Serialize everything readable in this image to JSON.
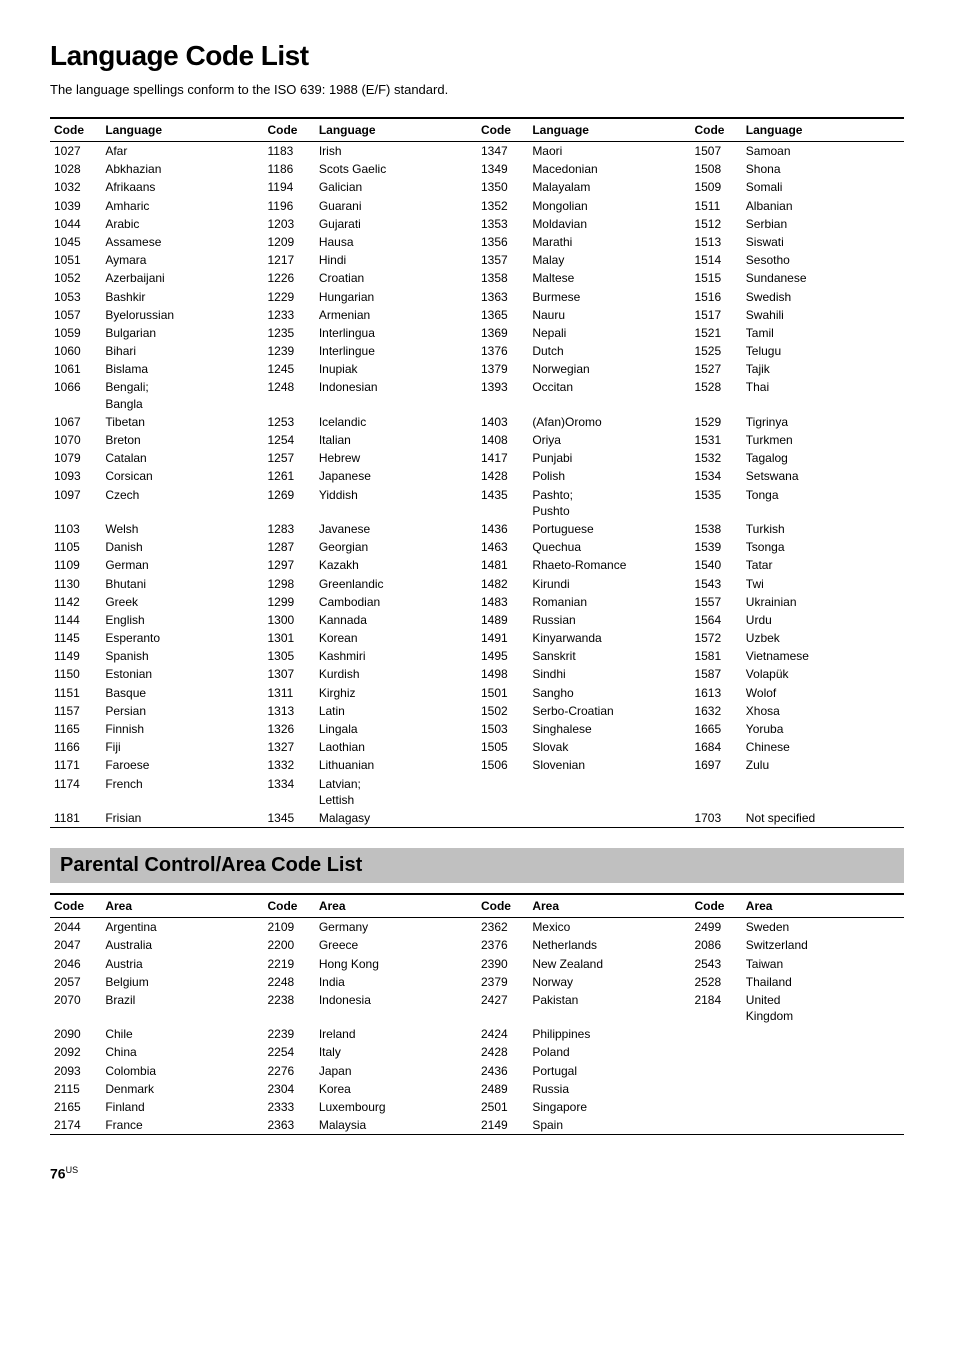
{
  "page": {
    "title": "Language Code List",
    "subtitle": "The language spellings conform to the ISO 639: 1988 (E/F) standard.",
    "page_number": "76",
    "page_suffix": "US"
  },
  "language_table": {
    "columns": [
      {
        "code_header": "Code",
        "lang_header": "Language"
      },
      {
        "code_header": "Code",
        "lang_header": "Language"
      },
      {
        "code_header": "Code",
        "lang_header": "Language"
      },
      {
        "code_header": "Code",
        "lang_header": "Language"
      }
    ],
    "col1": [
      {
        "code": "1027",
        "lang": "Afar"
      },
      {
        "code": "1028",
        "lang": "Abkhazian"
      },
      {
        "code": "1032",
        "lang": "Afrikaans"
      },
      {
        "code": "1039",
        "lang": "Amharic"
      },
      {
        "code": "1044",
        "lang": "Arabic"
      },
      {
        "code": "1045",
        "lang": "Assamese"
      },
      {
        "code": "1051",
        "lang": "Aymara"
      },
      {
        "code": "1052",
        "lang": "Azerbaijani"
      },
      {
        "code": "1053",
        "lang": "Bashkir"
      },
      {
        "code": "1057",
        "lang": "Byelorussian"
      },
      {
        "code": "1059",
        "lang": "Bulgarian"
      },
      {
        "code": "1060",
        "lang": "Bihari"
      },
      {
        "code": "1061",
        "lang": "Bislama"
      },
      {
        "code": "1066",
        "lang": "Bengali; Bangla"
      },
      {
        "code": "1067",
        "lang": "Tibetan"
      },
      {
        "code": "1070",
        "lang": "Breton"
      },
      {
        "code": "1079",
        "lang": "Catalan"
      },
      {
        "code": "1093",
        "lang": "Corsican"
      },
      {
        "code": "1097",
        "lang": "Czech"
      },
      {
        "code": "1103",
        "lang": "Welsh"
      },
      {
        "code": "1105",
        "lang": "Danish"
      },
      {
        "code": "1109",
        "lang": "German"
      },
      {
        "code": "1130",
        "lang": "Bhutani"
      },
      {
        "code": "1142",
        "lang": "Greek"
      },
      {
        "code": "1144",
        "lang": "English"
      },
      {
        "code": "1145",
        "lang": "Esperanto"
      },
      {
        "code": "1149",
        "lang": "Spanish"
      },
      {
        "code": "1150",
        "lang": "Estonian"
      },
      {
        "code": "1151",
        "lang": "Basque"
      },
      {
        "code": "1157",
        "lang": "Persian"
      },
      {
        "code": "1165",
        "lang": "Finnish"
      },
      {
        "code": "1166",
        "lang": "Fiji"
      },
      {
        "code": "1171",
        "lang": "Faroese"
      },
      {
        "code": "1174",
        "lang": "French"
      },
      {
        "code": "1181",
        "lang": "Frisian"
      }
    ],
    "col2": [
      {
        "code": "1183",
        "lang": "Irish"
      },
      {
        "code": "1186",
        "lang": "Scots Gaelic"
      },
      {
        "code": "1194",
        "lang": "Galician"
      },
      {
        "code": "1196",
        "lang": "Guarani"
      },
      {
        "code": "1203",
        "lang": "Gujarati"
      },
      {
        "code": "1209",
        "lang": "Hausa"
      },
      {
        "code": "1217",
        "lang": "Hindi"
      },
      {
        "code": "1226",
        "lang": "Croatian"
      },
      {
        "code": "1229",
        "lang": "Hungarian"
      },
      {
        "code": "1233",
        "lang": "Armenian"
      },
      {
        "code": "1235",
        "lang": "Interlingua"
      },
      {
        "code": "1239",
        "lang": "Interlingue"
      },
      {
        "code": "1245",
        "lang": "Inupiak"
      },
      {
        "code": "1248",
        "lang": "Indonesian"
      },
      {
        "code": "1253",
        "lang": "Icelandic"
      },
      {
        "code": "1254",
        "lang": "Italian"
      },
      {
        "code": "1257",
        "lang": "Hebrew"
      },
      {
        "code": "1261",
        "lang": "Japanese"
      },
      {
        "code": "1269",
        "lang": "Yiddish"
      },
      {
        "code": "1283",
        "lang": "Javanese"
      },
      {
        "code": "1287",
        "lang": "Georgian"
      },
      {
        "code": "1297",
        "lang": "Kazakh"
      },
      {
        "code": "1298",
        "lang": "Greenlandic"
      },
      {
        "code": "1299",
        "lang": "Cambodian"
      },
      {
        "code": "1300",
        "lang": "Kannada"
      },
      {
        "code": "1301",
        "lang": "Korean"
      },
      {
        "code": "1305",
        "lang": "Kashmiri"
      },
      {
        "code": "1307",
        "lang": "Kurdish"
      },
      {
        "code": "1311",
        "lang": "Kirghiz"
      },
      {
        "code": "1313",
        "lang": "Latin"
      },
      {
        "code": "1326",
        "lang": "Lingala"
      },
      {
        "code": "1327",
        "lang": "Laothian"
      },
      {
        "code": "1332",
        "lang": "Lithuanian"
      },
      {
        "code": "1334",
        "lang": "Latvian; Lettish"
      },
      {
        "code": "1345",
        "lang": "Malagasy"
      }
    ],
    "col3": [
      {
        "code": "1347",
        "lang": "Maori"
      },
      {
        "code": "1349",
        "lang": "Macedonian"
      },
      {
        "code": "1350",
        "lang": "Malayalam"
      },
      {
        "code": "1352",
        "lang": "Mongolian"
      },
      {
        "code": "1353",
        "lang": "Moldavian"
      },
      {
        "code": "1356",
        "lang": "Marathi"
      },
      {
        "code": "1357",
        "lang": "Malay"
      },
      {
        "code": "1358",
        "lang": "Maltese"
      },
      {
        "code": "1363",
        "lang": "Burmese"
      },
      {
        "code": "1365",
        "lang": "Nauru"
      },
      {
        "code": "1369",
        "lang": "Nepali"
      },
      {
        "code": "1376",
        "lang": "Dutch"
      },
      {
        "code": "1379",
        "lang": "Norwegian"
      },
      {
        "code": "1393",
        "lang": "Occitan"
      },
      {
        "code": "1403",
        "lang": "(Afan)Oromo"
      },
      {
        "code": "1408",
        "lang": "Oriya"
      },
      {
        "code": "1417",
        "lang": "Punjabi"
      },
      {
        "code": "1428",
        "lang": "Polish"
      },
      {
        "code": "1435",
        "lang": "Pashto; Pushto"
      },
      {
        "code": "1436",
        "lang": "Portuguese"
      },
      {
        "code": "1463",
        "lang": "Quechua"
      },
      {
        "code": "1481",
        "lang": "Rhaeto-Romance"
      },
      {
        "code": "1482",
        "lang": "Kirundi"
      },
      {
        "code": "1483",
        "lang": "Romanian"
      },
      {
        "code": "1489",
        "lang": "Russian"
      },
      {
        "code": "1491",
        "lang": "Kinyarwanda"
      },
      {
        "code": "1495",
        "lang": "Sanskrit"
      },
      {
        "code": "1498",
        "lang": "Sindhi"
      },
      {
        "code": "1501",
        "lang": "Sangho"
      },
      {
        "code": "1502",
        "lang": "Serbo-Croatian"
      },
      {
        "code": "1503",
        "lang": "Singhalese"
      },
      {
        "code": "1505",
        "lang": "Slovak"
      },
      {
        "code": "1506",
        "lang": "Slovenian"
      }
    ],
    "col4": [
      {
        "code": "1507",
        "lang": "Samoan"
      },
      {
        "code": "1508",
        "lang": "Shona"
      },
      {
        "code": "1509",
        "lang": "Somali"
      },
      {
        "code": "1511",
        "lang": "Albanian"
      },
      {
        "code": "1512",
        "lang": "Serbian"
      },
      {
        "code": "1513",
        "lang": "Siswati"
      },
      {
        "code": "1514",
        "lang": "Sesotho"
      },
      {
        "code": "1515",
        "lang": "Sundanese"
      },
      {
        "code": "1516",
        "lang": "Swedish"
      },
      {
        "code": "1517",
        "lang": "Swahili"
      },
      {
        "code": "1521",
        "lang": "Tamil"
      },
      {
        "code": "1525",
        "lang": "Telugu"
      },
      {
        "code": "1527",
        "lang": "Tajik"
      },
      {
        "code": "1528",
        "lang": "Thai"
      },
      {
        "code": "1529",
        "lang": "Tigrinya"
      },
      {
        "code": "1531",
        "lang": "Turkmen"
      },
      {
        "code": "1532",
        "lang": "Tagalog"
      },
      {
        "code": "1534",
        "lang": "Setswana"
      },
      {
        "code": "1535",
        "lang": "Tonga"
      },
      {
        "code": "1538",
        "lang": "Turkish"
      },
      {
        "code": "1539",
        "lang": "Tsonga"
      },
      {
        "code": "1540",
        "lang": "Tatar"
      },
      {
        "code": "1543",
        "lang": "Twi"
      },
      {
        "code": "1557",
        "lang": "Ukrainian"
      },
      {
        "code": "1564",
        "lang": "Urdu"
      },
      {
        "code": "1572",
        "lang": "Uzbek"
      },
      {
        "code": "1581",
        "lang": "Vietnamese"
      },
      {
        "code": "1587",
        "lang": "Volapük"
      },
      {
        "code": "1613",
        "lang": "Wolof"
      },
      {
        "code": "1632",
        "lang": "Xhosa"
      },
      {
        "code": "1665",
        "lang": "Yoruba"
      },
      {
        "code": "1684",
        "lang": "Chinese"
      },
      {
        "code": "1697",
        "lang": "Zulu"
      },
      {
        "code": "",
        "lang": ""
      },
      {
        "code": "1703",
        "lang": "Not specified"
      }
    ]
  },
  "parental_section": {
    "title": "Parental Control/Area Code List",
    "columns": [
      {
        "code_header": "Code",
        "area_header": "Area"
      },
      {
        "code_header": "Code",
        "area_header": "Area"
      },
      {
        "code_header": "Code",
        "area_header": "Area"
      },
      {
        "code_header": "Code",
        "area_header": "Area"
      }
    ],
    "col1": [
      {
        "code": "2044",
        "area": "Argentina"
      },
      {
        "code": "2047",
        "area": "Australia"
      },
      {
        "code": "2046",
        "area": "Austria"
      },
      {
        "code": "2057",
        "area": "Belgium"
      },
      {
        "code": "2070",
        "area": "Brazil"
      },
      {
        "code": "2090",
        "area": "Chile"
      },
      {
        "code": "2092",
        "area": "China"
      },
      {
        "code": "2093",
        "area": "Colombia"
      },
      {
        "code": "2115",
        "area": "Denmark"
      },
      {
        "code": "2165",
        "area": "Finland"
      },
      {
        "code": "2174",
        "area": "France"
      }
    ],
    "col2": [
      {
        "code": "2109",
        "area": "Germany"
      },
      {
        "code": "2200",
        "area": "Greece"
      },
      {
        "code": "2219",
        "area": "Hong Kong"
      },
      {
        "code": "2248",
        "area": "India"
      },
      {
        "code": "2238",
        "area": "Indonesia"
      },
      {
        "code": "2239",
        "area": "Ireland"
      },
      {
        "code": "2254",
        "area": "Italy"
      },
      {
        "code": "2276",
        "area": "Japan"
      },
      {
        "code": "2304",
        "area": "Korea"
      },
      {
        "code": "2333",
        "area": "Luxembourg"
      },
      {
        "code": "2363",
        "area": "Malaysia"
      }
    ],
    "col3": [
      {
        "code": "2362",
        "area": "Mexico"
      },
      {
        "code": "2376",
        "area": "Netherlands"
      },
      {
        "code": "2390",
        "area": "New Zealand"
      },
      {
        "code": "2379",
        "area": "Norway"
      },
      {
        "code": "2427",
        "area": "Pakistan"
      },
      {
        "code": "2424",
        "area": "Philippines"
      },
      {
        "code": "2428",
        "area": "Poland"
      },
      {
        "code": "2436",
        "area": "Portugal"
      },
      {
        "code": "2489",
        "area": "Russia"
      },
      {
        "code": "2501",
        "area": "Singapore"
      },
      {
        "code": "2149",
        "area": "Spain"
      }
    ],
    "col4": [
      {
        "code": "2499",
        "area": "Sweden"
      },
      {
        "code": "2086",
        "area": "Switzerland"
      },
      {
        "code": "2543",
        "area": "Taiwan"
      },
      {
        "code": "2528",
        "area": "Thailand"
      },
      {
        "code": "2184",
        "area": "United Kingdom"
      }
    ]
  }
}
